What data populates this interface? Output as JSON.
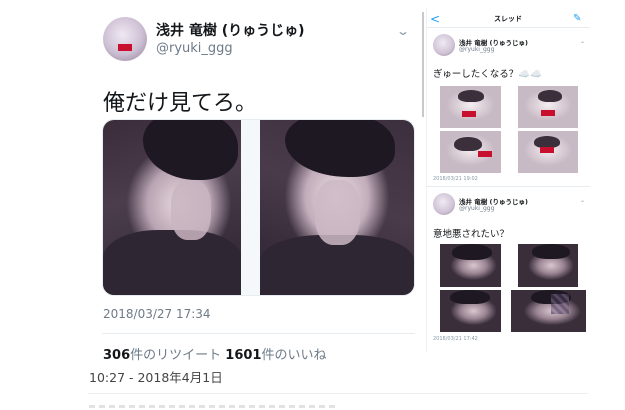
{
  "main_tweet": {
    "display_name": "浅井 竜樹 (りゅうじゅ)",
    "handle": "@ryuki_ggg",
    "text": "俺だけ見てろ。",
    "timestamp": "2018/03/27 17:34",
    "stats": {
      "retweets_count": "306",
      "retweets_label": "件のリツイート",
      "likes_count": "1601",
      "likes_label": "件のいいね"
    },
    "photo_count": 2
  },
  "thread_panel": {
    "title": "スレッド",
    "back_icon": "chevron-left-icon",
    "compose_icon": "feather-icon",
    "tweets": [
      {
        "display_name": "浅井 竜樹 (りゅうじゅ)",
        "handle": "@ryuki_ggg",
        "text": "ぎゅーしたくなる？☁️☁️",
        "timestamp": "2018/03/21 19:02",
        "photo_count": 4
      },
      {
        "display_name": "浅井 竜樹 (りゅうじゅ)",
        "handle": "@ryuki_ggg",
        "text": "意地悪されたい？",
        "timestamp": "2018/03/21 17:42",
        "photo_count": 4
      }
    ]
  },
  "footer": {
    "post_time": "10:27 - 2018年4月1日"
  },
  "colors": {
    "accent": "#1da1f2",
    "muted_text": "#6d7b88",
    "brand_box": "#c8102e"
  }
}
